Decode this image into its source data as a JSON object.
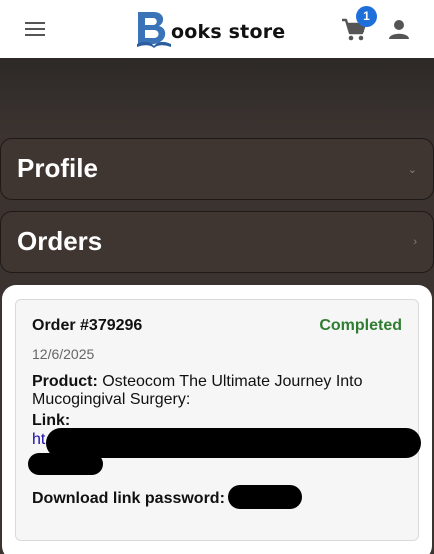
{
  "header": {
    "brand_text": "ooks store",
    "cart_count": "1",
    "icons": {
      "menu": "hamburger-icon",
      "cart": "cart-icon",
      "user": "user-icon"
    }
  },
  "accordions": [
    {
      "title": "Profile",
      "chevron": "⌄"
    },
    {
      "title": "Orders",
      "chevron": "›"
    }
  ],
  "order": {
    "number": "Order #379296",
    "status": "Completed",
    "date": "12/6/2025",
    "product_label": "Product:",
    "product_name": "Osteocom The Ultimate Journey Into Mucogingival Surgery:",
    "link_label": "Link:",
    "link_visible": "ht",
    "password_label": "Download link password:"
  },
  "colors": {
    "accent_blue": "#1e6fd9",
    "status_green": "#2f7d32",
    "dark_bg": "#3a3330"
  }
}
